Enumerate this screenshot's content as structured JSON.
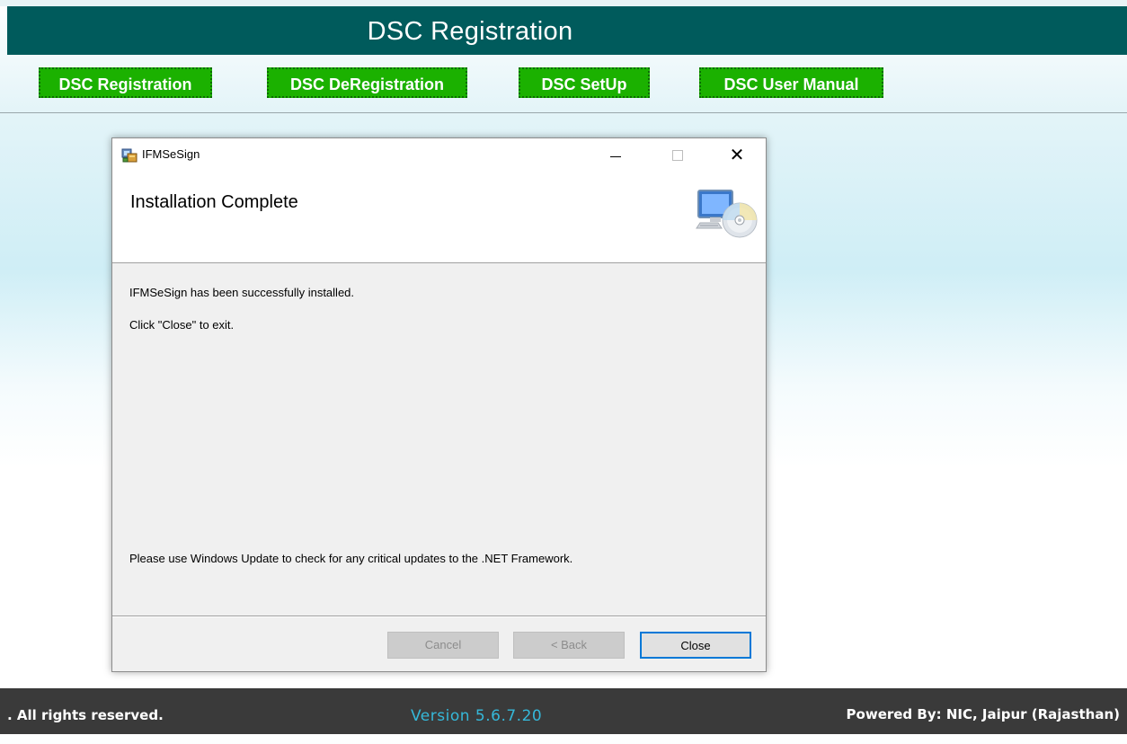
{
  "page": {
    "title": "DSC Registration"
  },
  "nav": {
    "items": [
      {
        "label": "DSC Registration"
      },
      {
        "label": "DSC DeRegistration"
      },
      {
        "label": "DSC SetUp"
      },
      {
        "label": "DSC User Manual"
      }
    ]
  },
  "dialog": {
    "window_title": "IFMSeSign",
    "heading": "Installation Complete",
    "message_installed": "IFMSeSign has been successfully installed.",
    "message_close": "Click \"Close\" to exit.",
    "message_update": "Please use Windows Update to check for any critical updates to the .NET Framework.",
    "buttons": {
      "cancel": "Cancel",
      "back": "< Back",
      "close": "Close"
    },
    "titlebar_close_glyph": "✕"
  },
  "footer": {
    "left": ". All rights reserved.",
    "center": "Version 5.6.7.20",
    "right": "Powered By: NIC, Jaipur (Rajasthan)"
  },
  "icons": {
    "app": "installer-icon",
    "setup": "computer-cd-icon"
  },
  "colors": {
    "header_bg": "#005b5c",
    "nav_button_bg": "#1bb100",
    "footer_bg": "#3a3a3a",
    "version_text": "#35b8d9",
    "focus_border": "#0078d7"
  }
}
